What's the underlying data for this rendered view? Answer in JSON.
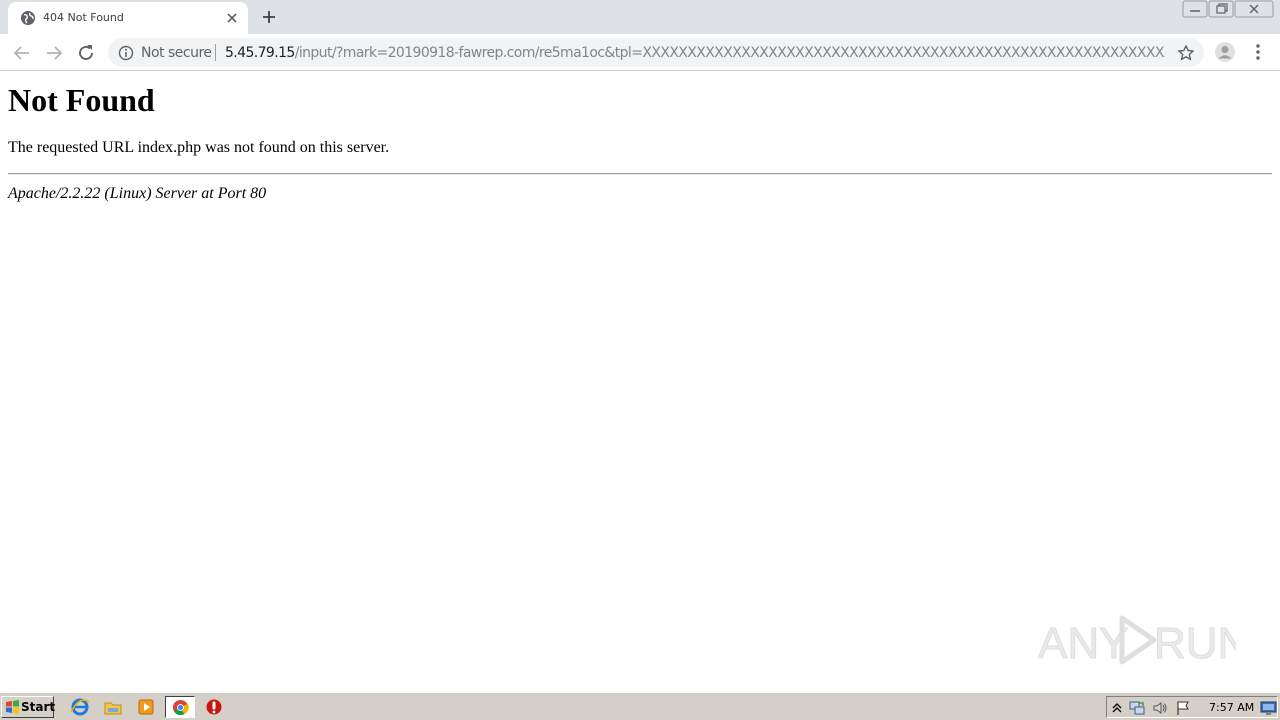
{
  "browser": {
    "tab": {
      "title": "404 Not Found"
    },
    "address_bar": {
      "security_label": "Not secure",
      "url_host": "5.45.79.15",
      "url_path": "/input/?mark=20190918-fawrep.com/re5ma1oc&tpl=XXXXXXXXXXXXXXXXXXXXXXXXXXXXXXXXXXXXXXXXXXXXXXXXXXXXXXXXXXXXXXX&engkey..."
    }
  },
  "page": {
    "heading": "Not Found",
    "message": "The requested URL index.php was not found on this server.",
    "server_signature": "Apache/2.2.22 (Linux) Server at Port 80"
  },
  "watermark": {
    "text_left": "ANY",
    "text_right": "RUN"
  },
  "taskbar": {
    "start_label": "Start",
    "pinned_icons": [
      "internet-explorer-icon",
      "file-explorer-icon",
      "media-player-icon",
      "chrome-icon",
      "stop-sign-icon"
    ],
    "tray_icons": [
      "show-hidden-icons-icon",
      "network-icon",
      "volume-icon",
      "action-center-flag-icon"
    ],
    "clock": "7:57 AM"
  },
  "colors": {
    "tabstrip_bg": "#dee1e6",
    "omnibox_bg": "#f1f3f4",
    "taskbar_bg": "#d4d0c8",
    "url_host": "#202124",
    "url_path": "#80868b"
  }
}
